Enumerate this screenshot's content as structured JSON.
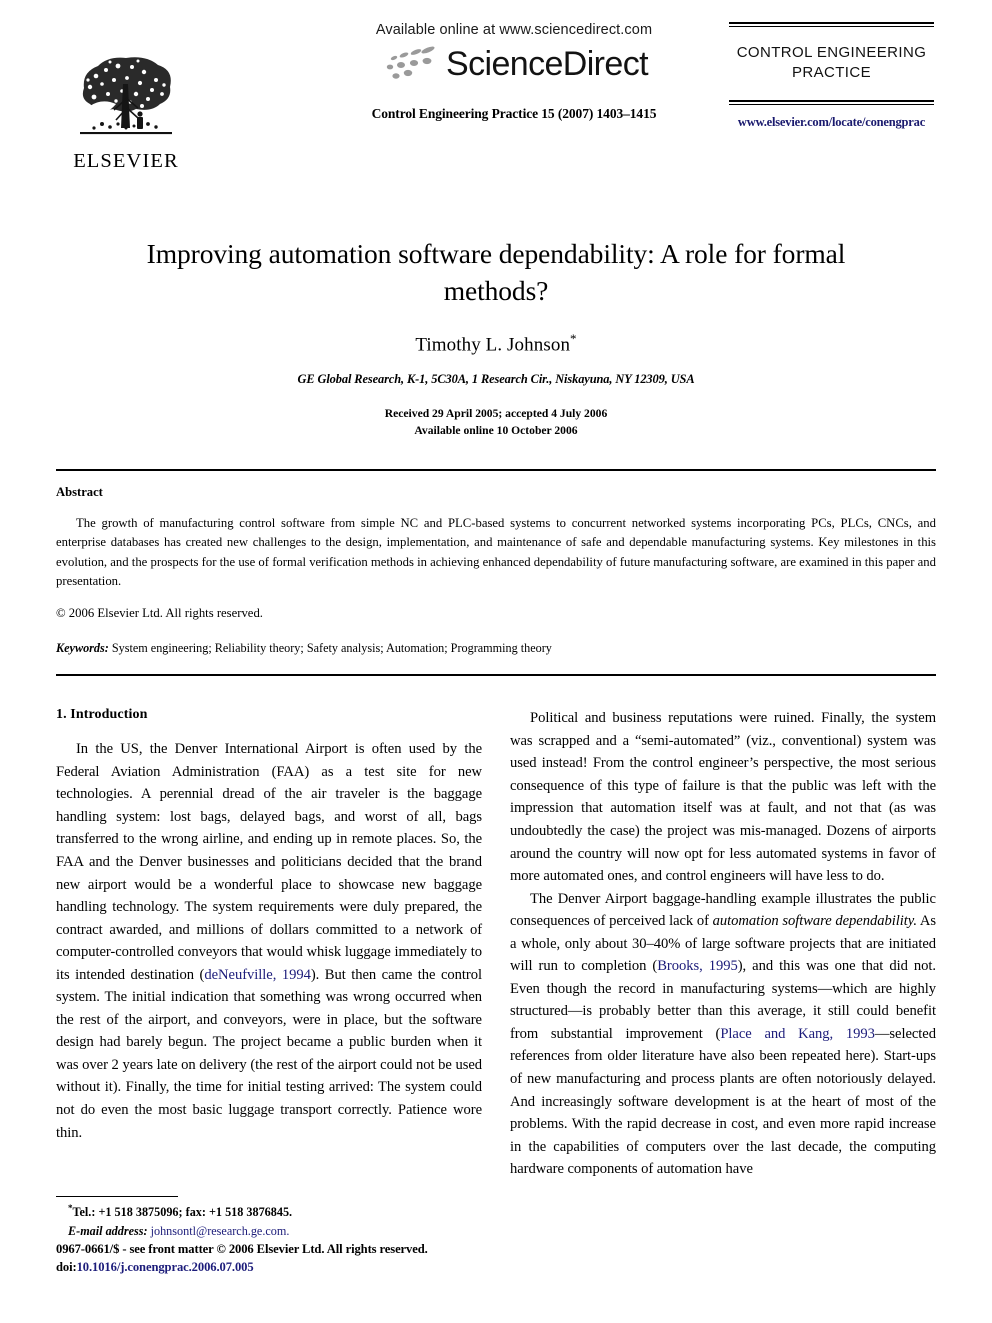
{
  "masthead": {
    "publisher_name": "ELSEVIER",
    "publisher_logo_icon": "elsevier-tree-icon",
    "available_online": "Available online at www.sciencedirect.com",
    "sciencedirect_wordmark": "ScienceDirect",
    "sciencedirect_swoosh_icon": "sciencedirect-swoosh-icon",
    "journal_reference": "Control Engineering Practice 15 (2007) 1403–1415",
    "journal_masthead_line1": "CONTROL ENGINEERING",
    "journal_masthead_line2": "PRACTICE",
    "journal_url": "www.elsevier.com/locate/conengprac"
  },
  "article": {
    "title": "Improving automation software dependability: A role for formal methods?",
    "author": "Timothy L. Johnson",
    "author_footnote_marker": "*",
    "affiliation": "GE Global Research, K-1, 5C30A, 1 Research Cir., Niskayuna, NY 12309, USA",
    "received_line": "Received 29 April 2005; accepted 4 July 2006",
    "available_line": "Available online 10 October 2006"
  },
  "abstract": {
    "heading": "Abstract",
    "text": "The growth of manufacturing control software from simple NC and PLC-based systems to concurrent networked systems incorporating PCs, PLCs, CNCs, and enterprise databases has created new challenges to the design, implementation, and maintenance of safe and dependable manufacturing systems. Key milestones in this evolution, and the prospects for the use of formal verification methods in achieving enhanced dependability of future manufacturing software, are examined in this paper and presentation.",
    "copyright": "© 2006 Elsevier Ltd. All rights reserved.",
    "keywords_label": "Keywords:",
    "keywords_value": "System engineering; Reliability theory; Safety analysis; Automation; Programming theory"
  },
  "body": {
    "section_heading": "1.  Introduction",
    "left_paragraph_1_part1": "In the US, the Denver International Airport is often used by the Federal Aviation Administration (FAA) as a test site for new technologies. A perennial dread of the air traveler is the baggage handling system: lost bags, delayed bags, and worst of all, bags transferred to the wrong airline, and ending up in remote places. So, the FAA and the Denver businesses and politicians decided that the brand new airport would be a wonderful place to showcase new baggage handling technology. The system requirements were duly prepared, the contract awarded, and millions of dollars committed to a network of computer-controlled conveyors that would whisk luggage immediately to its intended destination (",
    "left_citation_1": "deNeufville, 1994",
    "left_paragraph_1_part2": "). But then came the control system. The initial indication that something was wrong occurred when the rest of the airport, and conveyors, were in place, but the software design had barely begun. The project became a public burden when it was over 2 years late on delivery (the rest of the airport could not be used without it). Finally, the time for initial testing arrived: The system could not do even the most basic luggage transport correctly. Patience wore thin.",
    "right_paragraph_1": "Political and business reputations were ruined. Finally, the system was scrapped and a “semi-automated” (viz., conventional) system was used instead! From the control engineer’s perspective, the most serious consequence of this type of failure is that the public was left with the impression that automation itself was at fault, and not that (as was undoubtedly the case) the project was mis-managed. Dozens of airports around the country will now opt for less automated systems in favor of more automated ones, and control engineers will have less to do.",
    "right_paragraph_2_part1": "The Denver Airport baggage-handling example illustrates the public consequences of perceived lack of ",
    "right_paragraph_2_italic": "automation software dependability.",
    "right_paragraph_2_part2": " As a whole, only about 30–40% of large software projects that are initiated will run to completion (",
    "right_citation_1": "Brooks, 1995",
    "right_paragraph_2_part3": "), and this was one that did not. Even though the record in manufacturing systems—which are highly structured—is probably better than this average, it still could benefit from substantial improvement (",
    "right_citation_2": "Place and Kang, 1993",
    "right_paragraph_2_part4": "—selected references from older literature have also been repeated here). Start-ups of new manufacturing and process plants are often notoriously delayed. And increasingly software development is at the heart of most of the problems. With the rapid decrease in cost, and even more rapid increase in the capabilities of computers over the last decade, the computing hardware components of automation have"
  },
  "footnote": {
    "marker": "*",
    "tel_fax": "Tel.: +1 518 3875096; fax: +1 518 3876845.",
    "email_label": "E-mail address:",
    "email_value": "johnsontl@research.ge.com."
  },
  "footer": {
    "issn_line": "0967-0661/$ - see front matter © 2006 Elsevier Ltd. All rights reserved.",
    "doi_label": "doi:",
    "doi_value": "10.1016/j.conengprac.2006.07.005"
  },
  "colors": {
    "link_blue": "#1c1c7a",
    "text_black": "#000000",
    "swoosh_gray": "#9a9a9a"
  }
}
